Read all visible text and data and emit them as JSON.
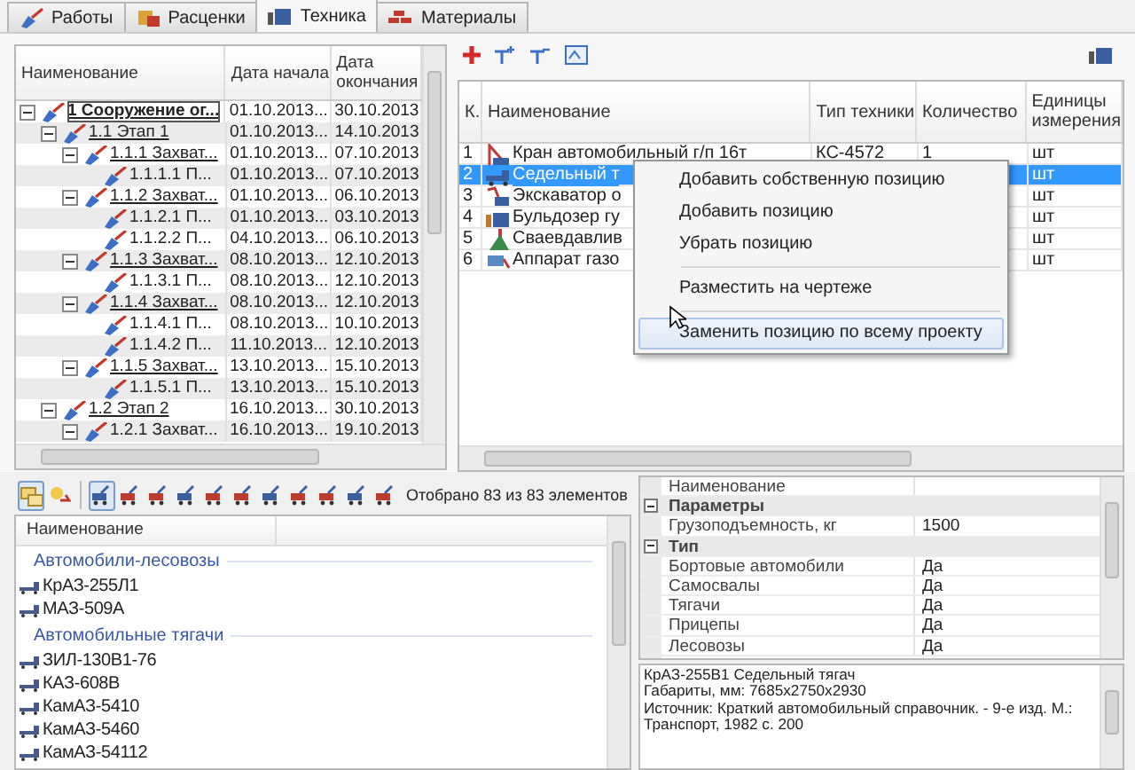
{
  "tabs": [
    {
      "label": "Работы",
      "selected": false
    },
    {
      "label": "Расценки",
      "selected": false
    },
    {
      "label": "Техника",
      "selected": true
    },
    {
      "label": "Материалы",
      "selected": false
    }
  ],
  "tree": {
    "columns": [
      "Наименование",
      "Дата начала",
      "Дата окончания"
    ],
    "nodes": [
      {
        "name": "1 Сооружение ог...",
        "start": "01.10.2013...",
        "end": "30.10.2013",
        "selected": true,
        "expanded": true,
        "children": [
          {
            "name": "1.1 Этап 1",
            "start": "01.10.2013...",
            "end": "14.10.2013",
            "selected": false,
            "expanded": true,
            "children": [
              {
                "name": "1.1.1 Захват...",
                "start": "01.10.2013...",
                "end": "07.10.2013",
                "selected": false,
                "expanded": true,
                "children": [
                  {
                    "name": "1.1.1.1 П...",
                    "start": "01.10.2013...",
                    "end": "07.10.2013",
                    "selected": false
                  }
                ]
              },
              {
                "name": "1.1.2 Захват...",
                "start": "01.10.2013...",
                "end": "06.10.2013",
                "selected": false,
                "expanded": true,
                "children": [
                  {
                    "name": "1.1.2.1 П...",
                    "start": "01.10.2013...",
                    "end": "03.10.2013",
                    "selected": false
                  },
                  {
                    "name": "1.1.2.2 П...",
                    "start": "04.10.2013...",
                    "end": "06.10.2013",
                    "selected": false
                  }
                ]
              },
              {
                "name": "1.1.3 Захват...",
                "start": "08.10.2013...",
                "end": "12.10.2013",
                "selected": false,
                "expanded": true,
                "children": [
                  {
                    "name": "1.1.3.1 П...",
                    "start": "08.10.2013...",
                    "end": "12.10.2013",
                    "selected": false
                  }
                ]
              },
              {
                "name": "1.1.4 Захват...",
                "start": "08.10.2013...",
                "end": "12.10.2013",
                "selected": false,
                "expanded": true,
                "children": [
                  {
                    "name": "1.1.4.1 П...",
                    "start": "08.10.2013...",
                    "end": "10.10.2013",
                    "selected": false
                  },
                  {
                    "name": "1.1.4.2 П...",
                    "start": "11.10.2013...",
                    "end": "12.10.2013",
                    "selected": false
                  }
                ]
              },
              {
                "name": "1.1.5 Захват...",
                "start": "13.10.2013...",
                "end": "15.10.2013",
                "selected": false,
                "expanded": true,
                "children": [
                  {
                    "name": "1.1.5.1 П...",
                    "start": "13.10.2013...",
                    "end": "15.10.2013",
                    "selected": false
                  }
                ]
              }
            ]
          },
          {
            "name": "1.2 Этап 2",
            "start": "16.10.2013...",
            "end": "30.10.2013",
            "selected": false,
            "expanded": true,
            "children": [
              {
                "name": "1.2.1 Захват...",
                "start": "16.10.2013...",
                "end": "19.10.2013",
                "selected": false,
                "expanded": true
              }
            ]
          }
        ]
      }
    ]
  },
  "equipment": {
    "columns": [
      "К.",
      "Наименование",
      "Тип техники",
      "Количество",
      "Единицы измерения"
    ],
    "rows": [
      {
        "num": "1",
        "name": "Кран автомобильный г/п 16т",
        "type": "КС-4572",
        "quantity": "1",
        "unit": "шт",
        "selected": false
      },
      {
        "num": "2",
        "name": "Седельный т",
        "unit": "шт",
        "selected": true
      },
      {
        "num": "3",
        "name": "Экскаватор о",
        "unit": "шт",
        "selected": false
      },
      {
        "num": "4",
        "name": "Бульдозер гу",
        "unit": "шт",
        "selected": false
      },
      {
        "num": "5",
        "name": "Сваевдавлив",
        "unit": "шт",
        "selected": false
      },
      {
        "num": "6",
        "name": "Аппарат газо",
        "unit": "шт",
        "selected": false
      }
    ]
  },
  "context_menu": [
    {
      "kind": "item",
      "label": "Добавить собственную позицию",
      "highlighted": false
    },
    {
      "kind": "item",
      "label": "Добавить позицию",
      "highlighted": false
    },
    {
      "kind": "item",
      "label": "Убрать позицию",
      "highlighted": false
    },
    {
      "kind": "separator"
    },
    {
      "kind": "item",
      "label": "Разместить на чертеже",
      "highlighted": false
    },
    {
      "kind": "separator"
    },
    {
      "kind": "item",
      "label": "Заменить позицию по всему проекту",
      "highlighted": true
    }
  ],
  "filter_bar": {
    "view_buttons": [
      {
        "selected": true
      },
      {
        "selected": false
      }
    ],
    "filter_buttons": [
      {
        "selected": true
      },
      {
        "selected": false
      },
      {
        "selected": false
      },
      {
        "selected": false
      },
      {
        "selected": false
      },
      {
        "selected": false
      },
      {
        "selected": false
      },
      {
        "selected": false
      },
      {
        "selected": false
      },
      {
        "selected": false
      },
      {
        "selected": false
      }
    ],
    "status": "Отобрано 83 из 83 элементов"
  },
  "catalog": {
    "column": "Наименование",
    "groups": [
      {
        "title": "Автомобили-лесовозы",
        "items": [
          "КрАЗ-255Л1",
          "МАЗ-509А"
        ]
      },
      {
        "title": "Автомобильные тягачи",
        "items": [
          "ЗИЛ-130В1-76",
          "КАЗ-608В",
          "КамАЗ-5410",
          "КамАЗ-5460",
          "КамАЗ-54112"
        ]
      }
    ]
  },
  "properties": [
    {
      "kind": "property",
      "name": "Наименование"
    },
    {
      "kind": "category",
      "name": "Параметры",
      "expanded": true
    },
    {
      "kind": "property",
      "name": "Грузоподъемность, кг",
      "value": "1500"
    },
    {
      "kind": "category",
      "name": "Тип",
      "expanded": true
    },
    {
      "kind": "property",
      "name": "Бортовые автомобили",
      "value": "Да"
    },
    {
      "kind": "property",
      "name": "Самосвалы",
      "value": "Да"
    },
    {
      "kind": "property",
      "name": "Тягачи",
      "value": "Да"
    },
    {
      "kind": "property",
      "name": "Прицепы",
      "value": "Да"
    },
    {
      "kind": "property",
      "name": "Лесовозы",
      "value": "Да"
    }
  ],
  "description": [
    "КрАЗ-255В1 Седельный тягач",
    "Габариты, мм: 7685x2750x2930",
    "Источник: Краткий автомобильный справочник. - 9-е изд. М.:",
    "Транспорт, 1982 с. 200"
  ]
}
